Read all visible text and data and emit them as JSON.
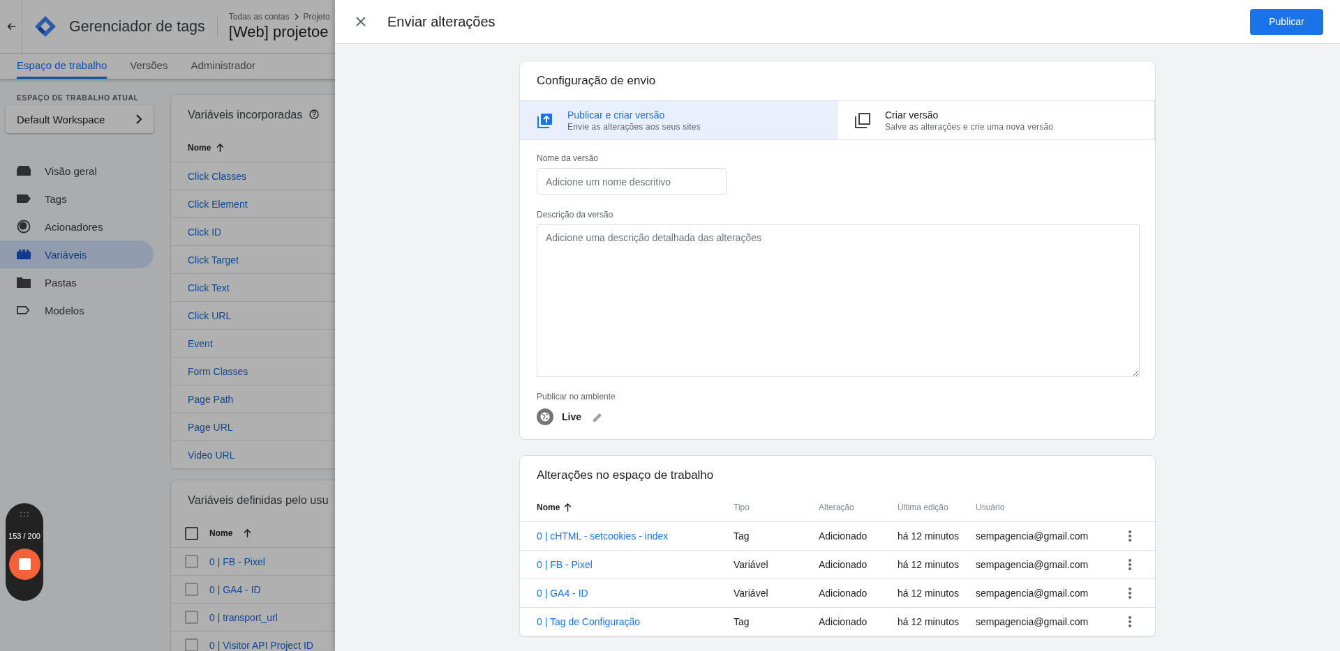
{
  "background_page": {
    "header": {
      "app_title": "Gerenciador de tags",
      "breadcrumb": [
        "Todas as contas",
        "Projeto"
      ],
      "container_title": "[Web] projetoe"
    },
    "nav_tabs": [
      {
        "label": "Espaço de trabalho",
        "selected": true
      },
      {
        "label": "Versões",
        "selected": false
      },
      {
        "label": "Administrador",
        "selected": false
      }
    ],
    "workspace": {
      "label": "ESPAÇO DE TRABALHO ATUAL",
      "name": "Default Workspace"
    },
    "sidebar": {
      "items": [
        {
          "label": "Visão geral",
          "kind": "overview",
          "selected": false
        },
        {
          "label": "Tags",
          "kind": "tag",
          "selected": false
        },
        {
          "label": "Acionadores",
          "kind": "trigger",
          "selected": false
        },
        {
          "label": "Variáveis",
          "kind": "variable",
          "selected": true
        },
        {
          "label": "Pastas",
          "kind": "folder",
          "selected": false
        },
        {
          "label": "Modelos",
          "kind": "template",
          "selected": false
        }
      ]
    },
    "builtin_variables": {
      "title": "Variáveis incorporadas",
      "column": "Nome",
      "rows": [
        "Click Classes",
        "Click Element",
        "Click ID",
        "Click Target",
        "Click Text",
        "Click URL",
        "Event",
        "Form Classes",
        "Page Path",
        "Page URL",
        "Video URL"
      ]
    },
    "user_variables": {
      "title": "Variáveis definidas pelo usu",
      "column": "Nome",
      "all_checked": false,
      "rows": [
        {
          "name": "0 | FB - Pixel",
          "checked": false
        },
        {
          "name": "0 | GA4 - ID",
          "checked": false
        },
        {
          "name": "0 | transport_url",
          "checked": false
        },
        {
          "name": "0 | Visitor API Project ID",
          "checked": false
        }
      ]
    }
  },
  "recorder": {
    "counter": "153 / 200"
  },
  "panel": {
    "title": "Enviar alterações",
    "publish_button": "Publicar",
    "submission_config": {
      "title": "Configuração de envio",
      "options": [
        {
          "kind": "publish",
          "title": "Publicar e criar versão",
          "subtitle": "Envie as alterações aos seus sites",
          "selected": true
        },
        {
          "kind": "version",
          "title": "Criar versão",
          "subtitle": "Salve as alterações e crie uma nova versão",
          "selected": false
        }
      ],
      "version_name": {
        "label": "Nome da versão",
        "placeholder": "Adicione um nome descritivo"
      },
      "version_description": {
        "label": "Descrição da versão",
        "placeholder": "Adicione uma descrição detalhada das alterações"
      },
      "environment": {
        "label": "Publicar no ambiente",
        "value": "Live"
      }
    },
    "workspace_changes": {
      "title": "Alterações no espaço de trabalho",
      "columns": [
        {
          "label": "Nome",
          "sorted": true
        },
        {
          "label": "Tipo",
          "sorted": false
        },
        {
          "label": "Alteração",
          "sorted": false
        },
        {
          "label": "Última edição",
          "sorted": false
        },
        {
          "label": "Usuário",
          "sorted": false
        }
      ],
      "rows": [
        [
          "0 | cHTML - setcookies - index",
          "Tag",
          "Adicionado",
          "há 12 minutos",
          "sempagencia@gmail.com"
        ],
        [
          "0 | FB - Pixel",
          "Variável",
          "Adicionado",
          "há 12 minutos",
          "sempagencia@gmail.com"
        ],
        [
          "0 | GA4 - ID",
          "Variável",
          "Adicionado",
          "há 12 minutos",
          "sempagencia@gmail.com"
        ],
        [
          "0 | Tag de Configuração",
          "Tag",
          "Adicionado",
          "há 12 minutos",
          "sempagencia@gmail.com"
        ]
      ]
    }
  }
}
